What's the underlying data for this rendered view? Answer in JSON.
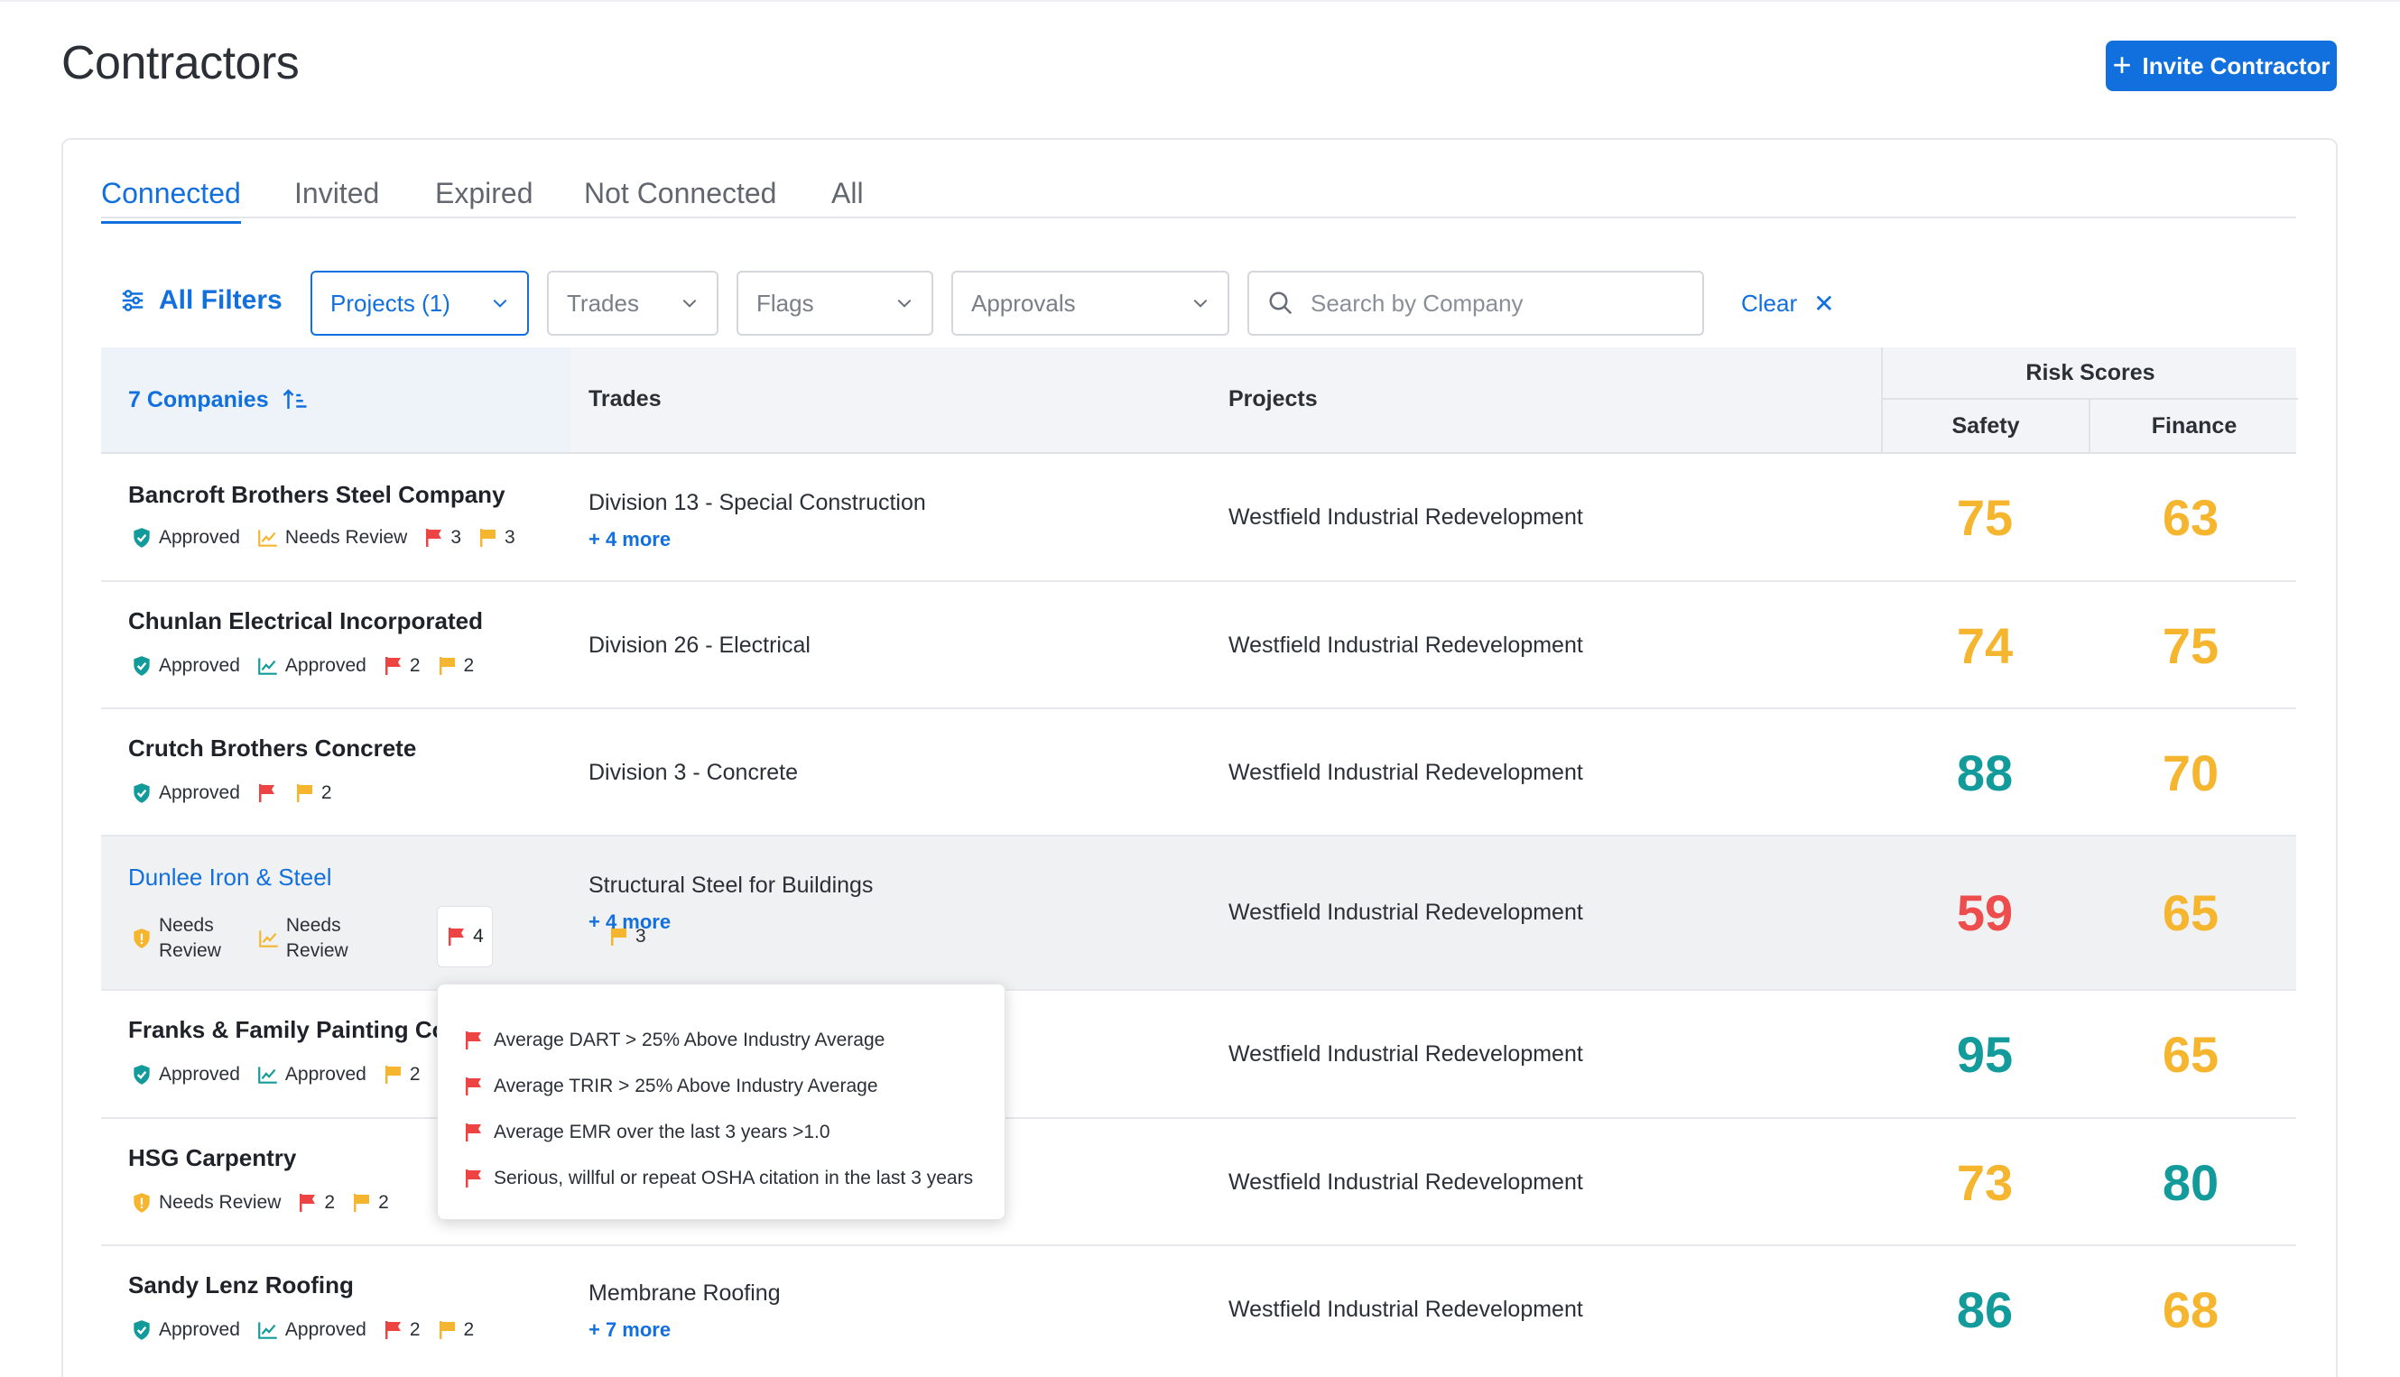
{
  "page": {
    "title": "Contractors",
    "invite_label": "Invite Contractor"
  },
  "tabs": [
    "Connected",
    "Invited",
    "Expired",
    "Not Connected",
    "All"
  ],
  "filters": {
    "all_filters": "All Filters",
    "projects": "Projects (1)",
    "trades": "Trades",
    "flags": "Flags",
    "approvals": "Approvals",
    "search_placeholder": "Search by Company",
    "clear": "Clear"
  },
  "table": {
    "companies_header": "7 Companies",
    "trades_header": "Trades",
    "projects_header": "Projects",
    "risk_header": "Risk Scores",
    "safety_header": "Safety",
    "finance_header": "Finance"
  },
  "rows": [
    {
      "name": "Bancroft Brothers Steel Company",
      "safety_badge": "Approved",
      "finance_badge": "Needs Review",
      "red_flags": "3",
      "yellow_flags": "3",
      "trade": "Division 13 - Special Construction",
      "more": "+ 4 more",
      "project": "Westfield Industrial Redevelopment",
      "safety": "75",
      "finance": "63"
    },
    {
      "name": "Chunlan Electrical Incorporated",
      "safety_badge": "Approved",
      "finance_badge": "Approved",
      "red_flags": "2",
      "yellow_flags": "2",
      "trade": "Division 26 - Electrical",
      "more": "",
      "project": "Westfield Industrial Redevelopment",
      "safety": "74",
      "finance": "75"
    },
    {
      "name": "Crutch Brothers Concrete",
      "safety_badge": "Approved",
      "finance_badge": "",
      "red_flags": "",
      "yellow_flags": "2",
      "trade": "Division 3 - Concrete",
      "more": "",
      "project": "Westfield Industrial Redevelopment",
      "safety": "88",
      "finance": "70"
    },
    {
      "name": "Dunlee Iron & Steel",
      "safety_badge_l1": "Needs",
      "safety_badge_l2": "Review",
      "finance_badge_l1": "Needs",
      "finance_badge_l2": "Review",
      "red_flags": "4",
      "yellow_flags": "3",
      "trade": "Structural Steel for Buildings",
      "more": "+ 4 more",
      "project": "Westfield Industrial Redevelopment",
      "safety": "59",
      "finance": "65"
    },
    {
      "name": "Franks & Family Painting Comp",
      "safety_badge": "Approved",
      "finance_badge": "Approved",
      "yellow_flags": "2",
      "project": "Westfield Industrial Redevelopment",
      "safety": "95",
      "finance": "65"
    },
    {
      "name": "HSG Carpentry",
      "safety_badge": "Needs Review",
      "red_flags": "2",
      "yellow_flags": "2",
      "project": "Westfield Industrial Redevelopment",
      "safety": "73",
      "finance": "80"
    },
    {
      "name": "Sandy Lenz Roofing",
      "safety_badge": "Approved",
      "finance_badge": "Approved",
      "red_flags": "2",
      "yellow_flags": "2",
      "trade": "Membrane Roofing",
      "more": "+ 7 more",
      "project": "Westfield Industrial Redevelopment",
      "safety": "86",
      "finance": "68"
    }
  ],
  "popover": [
    "Average DART > 25% Above Industry Average",
    "Average TRIR > 25% Above Industry Average",
    "Average EMR over the last 3 years >1.0",
    "Serious, willful or repeat OSHA citation in the last 3 years"
  ],
  "colors": {
    "accent": "#1170dd",
    "score_good": "#139a9a",
    "score_warn": "#f5b52e",
    "score_bad": "#ee4d4d",
    "flag_red": "#ee4343",
    "flag_yellow": "#f5b52e"
  }
}
